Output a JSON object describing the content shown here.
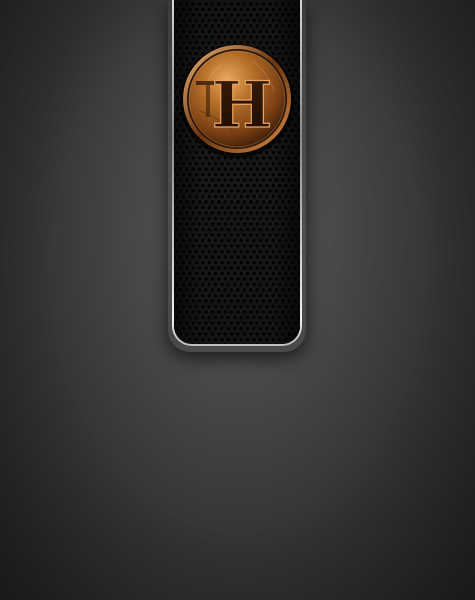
{
  "emblem": {
    "letter": "H",
    "icon": "bronze-h-medallion-icon"
  },
  "colors": {
    "background": "#3a3a3a",
    "tag_body": "#0c0c0c",
    "tag_rim": "#e6e6e6",
    "bronze_light": "#e09a55",
    "bronze_mid": "#a8621f",
    "bronze_dark": "#3a1c08"
  }
}
